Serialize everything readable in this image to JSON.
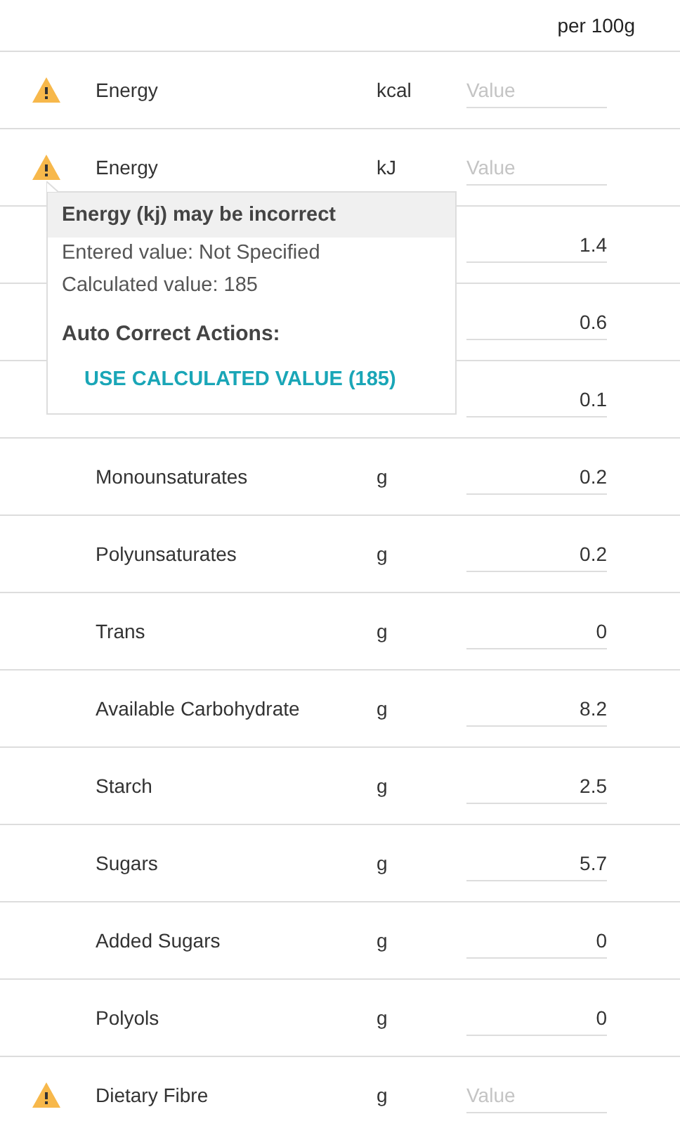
{
  "header": {
    "column": "per 100g"
  },
  "rows": [
    {
      "name": "Energy",
      "unit": "kcal",
      "placeholder": "Value",
      "warning": true
    },
    {
      "name": "Energy",
      "unit": "kJ",
      "placeholder": "Value",
      "warning": true
    },
    {
      "value": "1.4",
      "warning": false
    },
    {
      "value": "0.6",
      "warning": false
    },
    {
      "value": "0.1",
      "warning": false
    },
    {
      "name": "Monounsaturates",
      "unit": "g",
      "value": "0.2",
      "warning": false
    },
    {
      "name": "Polyunsaturates",
      "unit": "g",
      "value": "0.2",
      "warning": false
    },
    {
      "name": "Trans",
      "unit": "g",
      "value": "0",
      "warning": false
    },
    {
      "name": "Available Carbohydrate",
      "unit": "g",
      "value": "8.2",
      "warning": false
    },
    {
      "name": "Starch",
      "unit": "g",
      "value": "2.5",
      "warning": false
    },
    {
      "name": "Sugars",
      "unit": "g",
      "value": "5.7",
      "warning": false
    },
    {
      "name": "Added Sugars",
      "unit": "g",
      "value": "0",
      "warning": false
    },
    {
      "name": "Polyols",
      "unit": "g",
      "value": "0",
      "warning": false
    },
    {
      "name": "Dietary Fibre",
      "unit": "g",
      "placeholder": "Value",
      "warning": true
    }
  ],
  "tooltip": {
    "title": "Energy (kj) may be incorrect",
    "lines": [
      "Entered value: Not Specified",
      "Calculated value: 185"
    ],
    "actions_heading": "Auto Correct Actions:",
    "action": "USE CALCULATED VALUE (185)"
  }
}
